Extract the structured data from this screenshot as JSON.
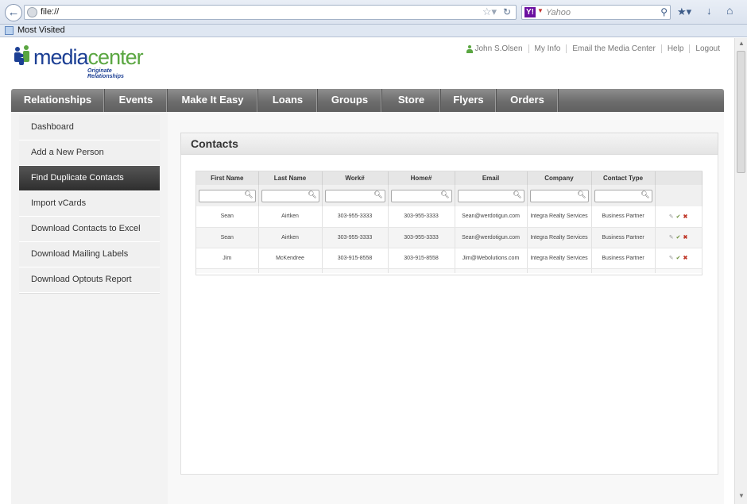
{
  "browser": {
    "url": "file://",
    "search_placeholder": "Yahoo",
    "bookmark_label": "Most Visited"
  },
  "logo": {
    "media": "media",
    "center": "center",
    "tagline": "Originate Relationships"
  },
  "top_links": {
    "user": "John S.Olsen",
    "my_info": "My Info",
    "email": "Email the Media Center",
    "help": "Help",
    "logout": "Logout"
  },
  "nav": [
    {
      "label": "Relationships"
    },
    {
      "label": "Events"
    },
    {
      "label": "Make It Easy"
    },
    {
      "label": "Loans"
    },
    {
      "label": "Groups"
    },
    {
      "label": "Store"
    },
    {
      "label": "Flyers"
    },
    {
      "label": "Orders"
    }
  ],
  "sidebar": [
    {
      "label": "Dashboard"
    },
    {
      "label": "Add a New Person"
    },
    {
      "label": "Find Duplicate Contacts",
      "active": true
    },
    {
      "label": "Import vCards"
    },
    {
      "label": "Download Contacts to Excel"
    },
    {
      "label": "Download Mailing Labels"
    },
    {
      "label": "Download Optouts Report"
    }
  ],
  "panel": {
    "title": "Contacts"
  },
  "table": {
    "columns": [
      "First Name",
      "Last Name",
      "Work#",
      "Home#",
      "Email",
      "Company",
      "Contact Type"
    ],
    "rows": [
      [
        "Sean",
        "Airtken",
        "303-955-3333",
        "303-955-3333",
        "Sean@werdotigun.com",
        "Integra Realty Services",
        "Business Partner"
      ],
      [
        "Sean",
        "Airtken",
        "303-955-3333",
        "303-955-3333",
        "Sean@werdotigun.com",
        "Integra Realty Services",
        "Business Partner"
      ],
      [
        "Jim",
        "McKendree",
        "303-915-8558",
        "303-915-8558",
        "Jim@Webolutions.com",
        "Integra Realty Services",
        "Business Partner"
      ]
    ]
  }
}
